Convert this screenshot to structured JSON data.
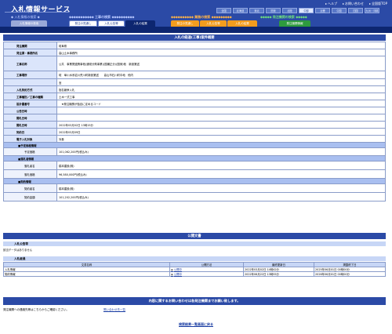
{
  "header": {
    "app_title": "入札情報サービス",
    "top_links": [
      "ヘルプ",
      "お問い合わせ",
      "全国版TOP"
    ],
    "regions_row1": [
      "全国",
      "北海道",
      "東北",
      "関東",
      "北陸",
      "中部",
      "近畿",
      "中国",
      "四国",
      "九州・沖縄"
    ],
    "regions_row2": [
      "事業",
      "中国",
      "四国",
      "九州・沖縄"
    ],
    "category_koji": "工事の検索",
    "category_gyomu": "業務の検索",
    "category_choutatsu": "発注機関の検索",
    "tab_search_left": "入札情報の検索",
    "tabs": {
      "t1": "発注の見通し",
      "t2": "入札公告等",
      "t3": "入札の結果",
      "t4": "発注の見通し",
      "t5": "入札公告等",
      "t6": "入札の結果",
      "t7": "発注機関情報"
    }
  },
  "summary": {
    "title": "入札の経過(工事)案件概要",
    "rows": [
      {
        "label": "発注機関",
        "value": "岐阜県"
      },
      {
        "label": "発注課・事務所名",
        "value": "高山土木事務所"
      },
      {
        "label": "工事名称",
        "value": "公共　事業関連興事他(通常分県事業)(国補正分)(国債)他　新設第送"
      },
      {
        "label": "工事場所",
        "value": "岐　阜川水系岩川荒川町新設第送　　高山市石川町中地　他内"
      },
      {
        "label": "",
        "value": "宜"
      },
      {
        "label": "入札契約方式",
        "value": "指名競争入札"
      },
      {
        "label": "工事種別／工事の種類",
        "value": "土木一式工事"
      },
      {
        "label": "設計書番号",
        "value": "　★発注機関が独自に定めるコード"
      },
      {
        "label": "公告日時",
        "value": ""
      },
      {
        "label": "開札日時",
        "value": ""
      },
      {
        "label": "開札日時",
        "value": "2022年03月02日 13時15分"
      },
      {
        "label": "契約日",
        "value": "2022年03月09日"
      },
      {
        "label": "電子入札対象",
        "value": "対象"
      }
    ],
    "group_yotei": "予定価格情報",
    "yotei_label": "予定価格",
    "yotei_value": "101,062,200円(税込み)",
    "group_rakusatsu": "落札者情報",
    "rakusatsu_name_label": "落札者名",
    "rakusatsu_name_value": "橋本建設(株)",
    "rakusatsu_price_label": "落札価格",
    "rakusatsu_price_value": "96,580,000円(税込み)",
    "group_keiyaku": "契約情報",
    "keiyaku_name_label": "契約者名",
    "keiyaku_name_value": "橋本建設(株)",
    "keiyaku_amount_label": "契約金額",
    "keiyaku_amount_value": "101,202,200円(税込み)"
  },
  "public_docs": {
    "title": "公開文書",
    "section1": "入札公告等",
    "no_data": "該当データはありません",
    "section2": "入札経過",
    "columns": [
      "文書名称",
      "公開方法",
      "最終更新日",
      "掲載終了日"
    ],
    "rows": [
      {
        "name": "入札情報",
        "method": "公開中",
        "updated": "2022年03月02日 14時42分",
        "end": "2025年06月01日 00時00分"
      },
      {
        "name": "契約情報",
        "method": "公開中",
        "updated": "2022年06月22日 13時55分",
        "end": "2026年06月01日 00時00分"
      }
    ]
  },
  "footer": {
    "notice": "内容に関するお問い合わせは各発注機関までお願い致します。",
    "contact_text": "発注機関への連絡先等はこちらからご確認ください。",
    "contact_link": "問い合わせ先一覧",
    "back_link": "検索結果一覧画面に戻る"
  },
  "colors": {
    "header_blue": "#2b4aa6",
    "dark_navy": "#0d2670",
    "orange": "#f29c1e",
    "green": "#2e9a3e"
  }
}
